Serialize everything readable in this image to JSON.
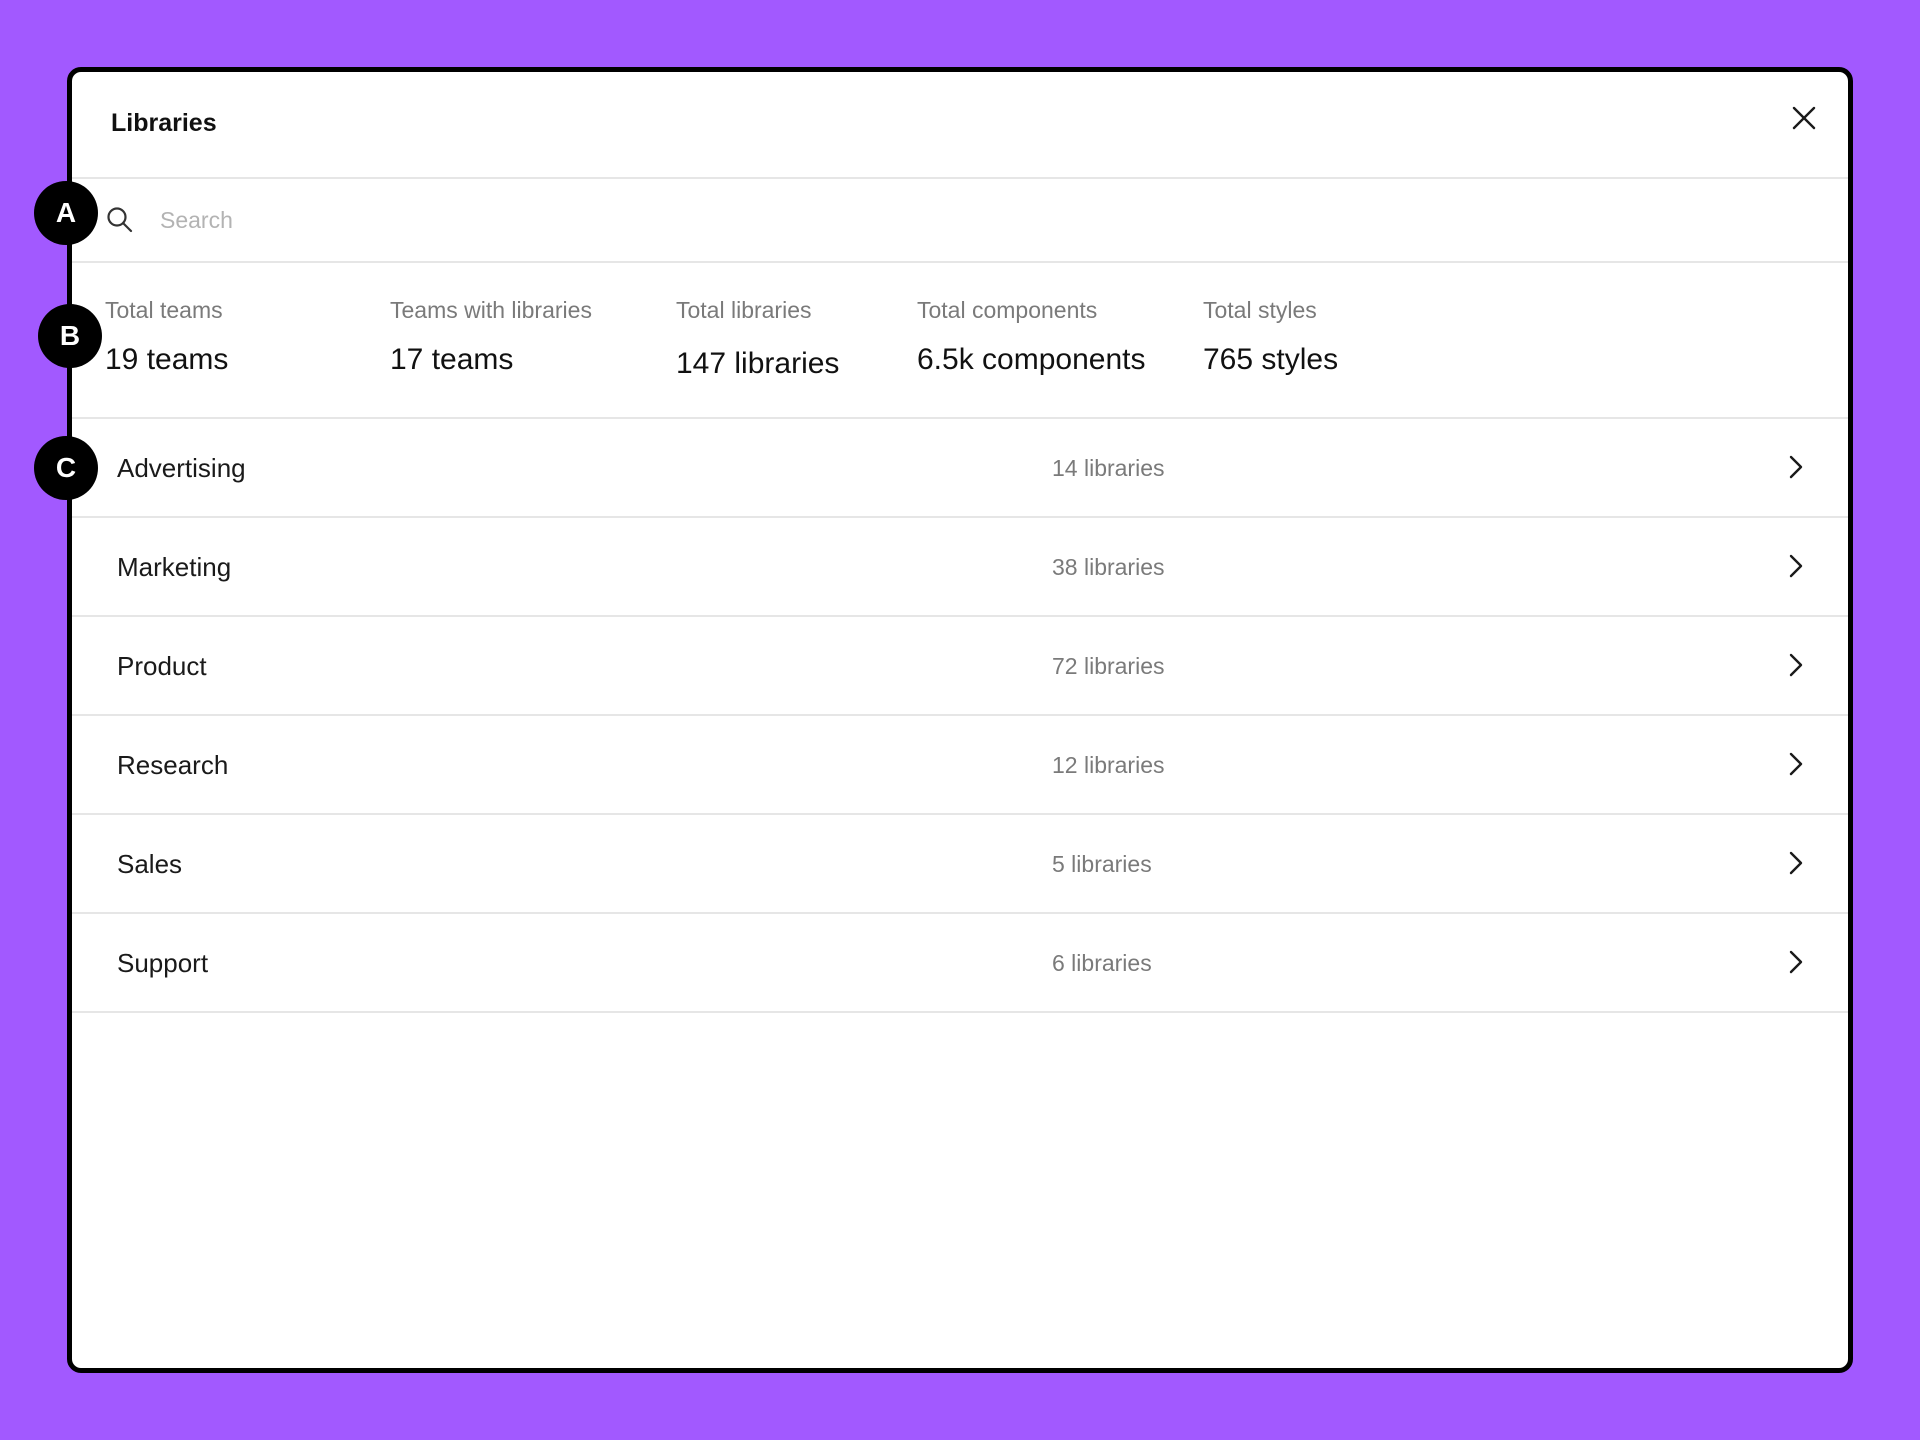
{
  "dialog": {
    "title": "Libraries",
    "close_icon": "close-icon"
  },
  "search": {
    "placeholder": "Search",
    "value": "",
    "icon": "search-icon"
  },
  "stats": [
    {
      "label": "Total teams",
      "value": "19 teams"
    },
    {
      "label": "Teams with libraries",
      "value": "17 teams"
    },
    {
      "label": "Total libraries",
      "value": "147 libraries"
    },
    {
      "label": "Total components",
      "value": "6.5k components"
    },
    {
      "label": "Total styles",
      "value": "765 styles"
    }
  ],
  "teams": [
    {
      "name": "Advertising",
      "count": "14 libraries"
    },
    {
      "name": "Marketing",
      "count": "38 libraries"
    },
    {
      "name": "Product",
      "count": "72 libraries"
    },
    {
      "name": "Research",
      "count": "12 libraries"
    },
    {
      "name": "Sales",
      "count": "5 libraries"
    },
    {
      "name": "Support",
      "count": "6 libraries"
    }
  ],
  "callouts": {
    "a": "A",
    "b": "B",
    "c": "C"
  },
  "colors": {
    "background": "#A259FF",
    "badge": "#000000",
    "divider": "#e6e6e6",
    "muted_text": "#7a7a7a"
  }
}
